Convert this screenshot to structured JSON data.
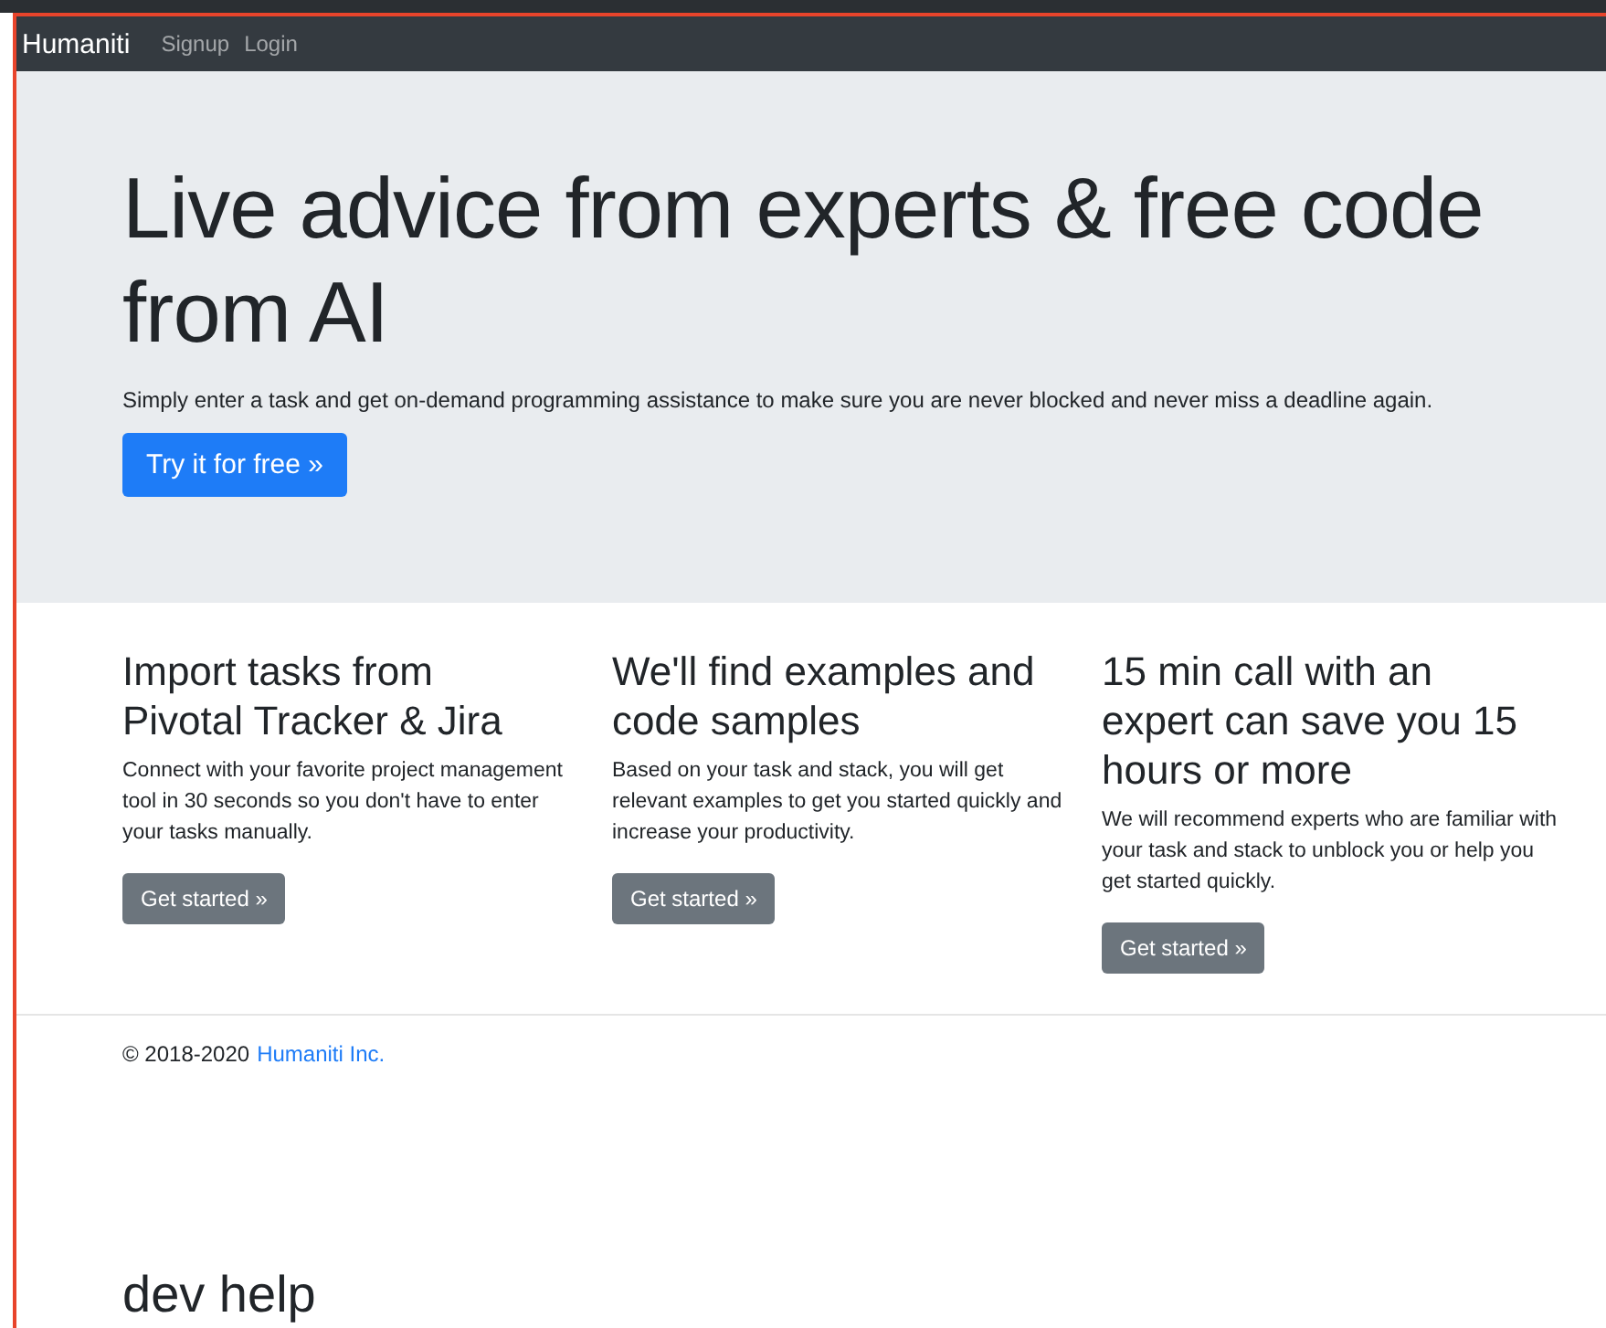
{
  "navbar": {
    "brand": "Humaniti",
    "links": [
      "Signup",
      "Login"
    ]
  },
  "hero": {
    "title": "Live advice from experts & free code from AI",
    "lead": "Simply enter a task and get on-demand programming assistance to make sure you are never blocked and never miss a deadline again.",
    "button": "Try it for free »"
  },
  "features": [
    {
      "title": "Import tasks from Pivotal Tracker & Jira",
      "text": "Connect with your favorite project management tool in 30 seconds so you don't have to enter your tasks manually.",
      "button": "Get started »"
    },
    {
      "title": "We'll find examples and code samples",
      "text": "Based on your task and stack, you will get relevant examples to get you started quickly and increase your productivity.",
      "button": "Get started »"
    },
    {
      "title": "15 min call with an expert can save you 15 hours or more",
      "text": "We will recommend experts who are familiar with your task and stack to unblock you or help you get started quickly.",
      "button": "Get started »"
    }
  ],
  "footer": {
    "copyright": "© 2018-2020",
    "link": "Humaniti Inc."
  },
  "section_heading": "dev help"
}
